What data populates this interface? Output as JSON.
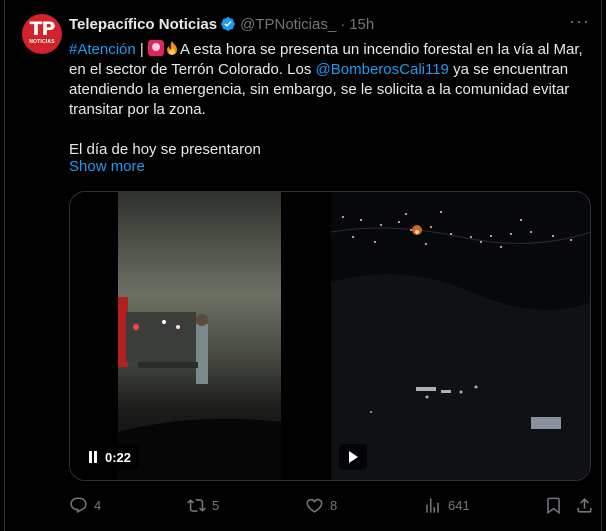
{
  "tweet": {
    "avatar": {
      "line1": "TP",
      "line2": "NOTICIAS"
    },
    "author_name": "Telepacífico Noticias",
    "handle": "@TPNoticias_",
    "separator": "·",
    "time": "15h",
    "text": {
      "hashtag": "#Atención",
      "pipe": " | ",
      "part1": "A esta hora se presenta un incendio forestal en la vía al Mar, en el sector de Terrón Colorado. Los ",
      "mention": "@BomberosCali119",
      "part2": " ya se encuentran atendiendo la emergencia, sin embargo, se le solicita a la comunidad evitar transitar por la zona.",
      "part3": "El día de hoy se presentaron"
    },
    "show_more": "Show more",
    "video_left": {
      "time": "0:22"
    },
    "actions": {
      "replies": "4",
      "reposts": "5",
      "likes": "8",
      "views": "641"
    }
  },
  "colors": {
    "accent": "#1d9bf0",
    "muted": "#71767b",
    "text": "#e7e9ea",
    "background": "#000000"
  }
}
